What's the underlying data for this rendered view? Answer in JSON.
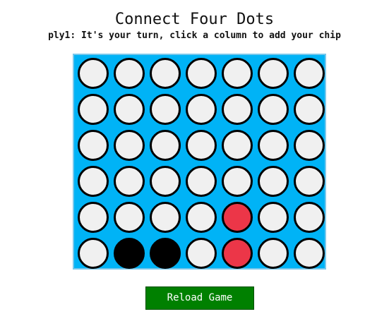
{
  "title": "Connect Four Dots",
  "status": "ply1: It's your turn, click a column to add your chip",
  "board": {
    "columns": 7,
    "rows": 6,
    "cells": [
      [
        "empty",
        "empty",
        "empty",
        "empty",
        "empty",
        "empty",
        "empty"
      ],
      [
        "empty",
        "empty",
        "empty",
        "empty",
        "empty",
        "empty",
        "empty"
      ],
      [
        "empty",
        "empty",
        "empty",
        "empty",
        "empty",
        "empty",
        "empty"
      ],
      [
        "empty",
        "empty",
        "empty",
        "empty",
        "empty",
        "empty",
        "empty"
      ],
      [
        "empty",
        "empty",
        "empty",
        "empty",
        "red",
        "empty",
        "empty"
      ],
      [
        "empty",
        "black",
        "black",
        "empty",
        "red",
        "empty",
        "empty"
      ]
    ]
  },
  "colors": {
    "board": "#00b3f6",
    "empty": "#f0f0f0",
    "red": "#ec3648",
    "black": "#000000",
    "button": "#008000"
  },
  "reload_button": "Reload Game"
}
